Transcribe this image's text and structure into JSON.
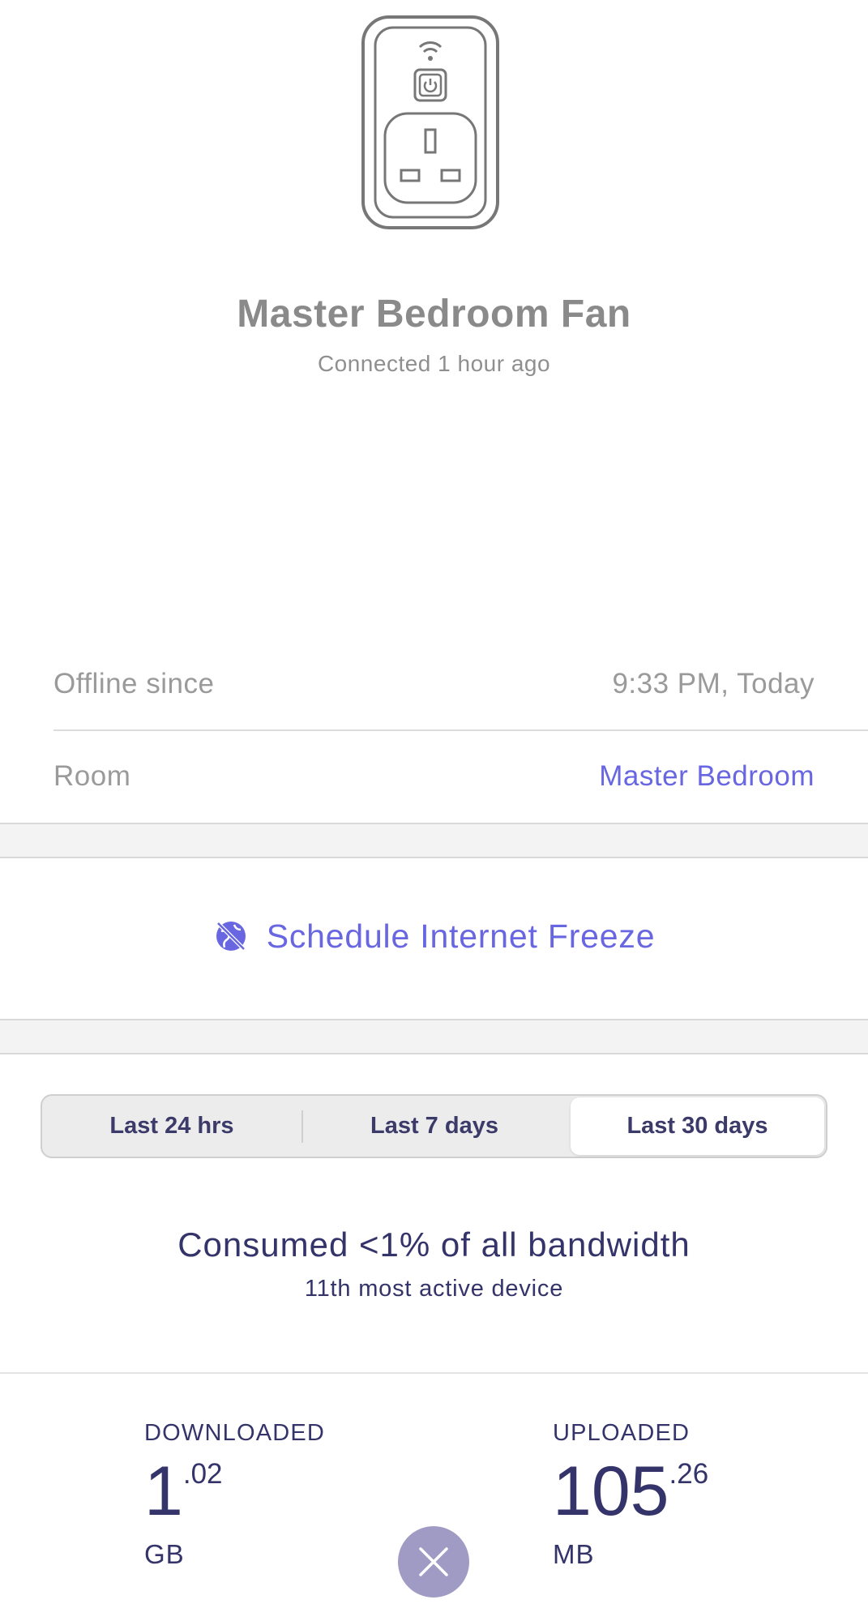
{
  "device": {
    "name": "Master Bedroom Fan",
    "status": "Connected 1 hour ago",
    "illustration_icon": "smart-plug-icon"
  },
  "info": {
    "offline_label": "Offline since",
    "offline_value": "9:33 PM, Today",
    "room_label": "Room",
    "room_value": "Master Bedroom"
  },
  "freeze": {
    "label": "Schedule Internet Freeze",
    "icon": "internet-freeze-icon"
  },
  "range_tabs": {
    "items": [
      "Last 24 hrs",
      "Last 7 days",
      "Last 30 days"
    ],
    "selected": "Last 30 days"
  },
  "bandwidth": {
    "headline": "Consumed <1% of all bandwidth",
    "rank": "11th  most active device"
  },
  "stats": {
    "downloaded": {
      "label": "DOWNLOADED",
      "whole": "1",
      "fraction": ".02",
      "unit": "GB"
    },
    "uploaded": {
      "label": "UPLOADED",
      "whole": "105",
      "fraction": ".26",
      "unit": "MB"
    }
  },
  "close_icon": "close-icon",
  "colors": {
    "accent": "#6866e0",
    "text_dark": "#34336a",
    "text_muted": "#8a8a8a",
    "close_button": "#9f9bc4"
  }
}
